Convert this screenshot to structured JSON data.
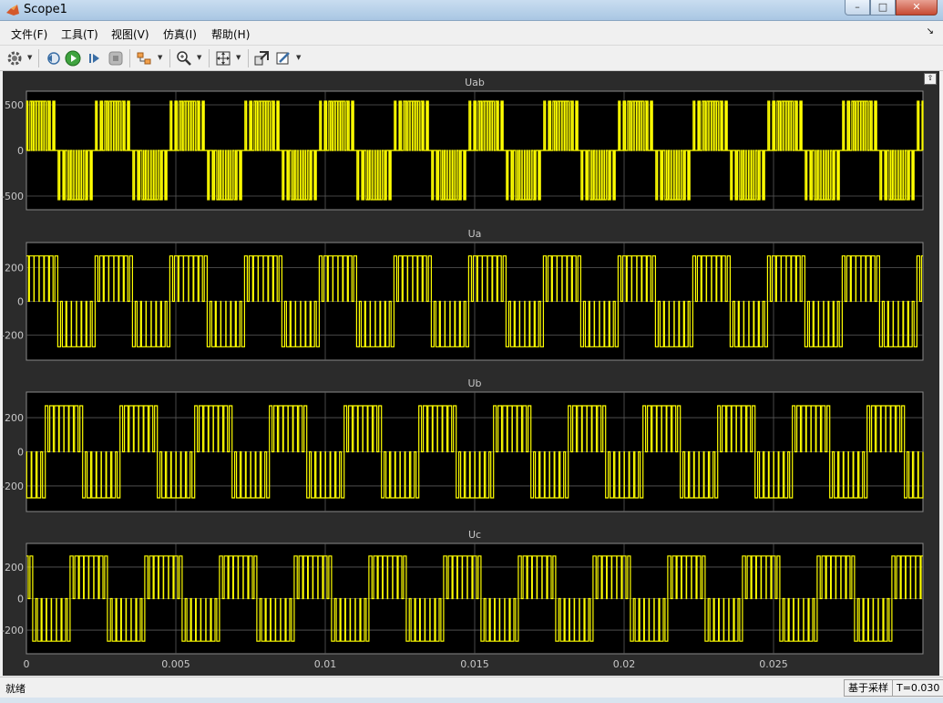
{
  "window": {
    "title": "Scope1"
  },
  "menu": [
    {
      "label": "文件(F)"
    },
    {
      "label": "工具(T)"
    },
    {
      "label": "视图(V)"
    },
    {
      "label": "仿真(I)"
    },
    {
      "label": "帮助(H)"
    }
  ],
  "toolbar": {
    "icons": [
      "gear-icon",
      "step-back-icon",
      "run-icon",
      "step-forward-icon",
      "stop-icon",
      "signal-selector-icon",
      "zoom-icon",
      "autoscale-icon",
      "highlight-block-icon",
      "style-icon"
    ]
  },
  "status": {
    "left": "就绪",
    "mode": "基于采样",
    "time": "T=0.030"
  },
  "colors": {
    "trace": "#ffff00",
    "axes_bg": "#000000",
    "figure_bg": "#2b2b2b",
    "grid": "#5a5a5a",
    "text": "#c8c8c8"
  },
  "chart_data": [
    {
      "type": "line",
      "title": "Uab",
      "xlim": [
        0,
        0.03
      ],
      "ylim": [
        -650,
        650
      ],
      "yticks": [
        -500,
        0,
        500
      ],
      "ytick_labels": [
        "-500",
        "0",
        "500"
      ],
      "xticks": [
        0,
        0.005,
        0.01,
        0.015,
        0.02,
        0.025
      ],
      "series": [
        {
          "signal": "line-to-line PWM, levels ±540/±270/0",
          "fundamental_hz": 400,
          "carrier_hz": 6000,
          "phase_deg": 0
        }
      ]
    },
    {
      "type": "line",
      "title": "Ua",
      "xlim": [
        0,
        0.03
      ],
      "ylim": [
        -350,
        350
      ],
      "yticks": [
        -200,
        0,
        200
      ],
      "ytick_labels": [
        "-200",
        "0",
        "200"
      ],
      "xticks": [
        0,
        0.005,
        0.01,
        0.015,
        0.02,
        0.025
      ],
      "series": [
        {
          "signal": "phase PWM, levels ±270/0",
          "fundamental_hz": 400,
          "carrier_hz": 6000,
          "phase_deg": 30
        }
      ]
    },
    {
      "type": "line",
      "title": "Ub",
      "xlim": [
        0,
        0.03
      ],
      "ylim": [
        -350,
        350
      ],
      "yticks": [
        -200,
        0,
        200
      ],
      "ytick_labels": [
        "-200",
        "0",
        "200"
      ],
      "xticks": [
        0,
        0.005,
        0.01,
        0.015,
        0.02,
        0.025
      ],
      "series": [
        {
          "signal": "phase PWM, levels ±270/0",
          "fundamental_hz": 400,
          "carrier_hz": 6000,
          "phase_deg": -90
        }
      ]
    },
    {
      "type": "line",
      "title": "Uc",
      "xlim": [
        0,
        0.03
      ],
      "ylim": [
        -350,
        350
      ],
      "yticks": [
        -200,
        0,
        200
      ],
      "ytick_labels": [
        "-200",
        "0",
        "200"
      ],
      "xticks": [
        0,
        0.005,
        0.01,
        0.015,
        0.02,
        0.025
      ],
      "xtick_labels": [
        "0",
        "0.005",
        "0.01",
        "0.015",
        "0.02",
        "0.025"
      ],
      "series": [
        {
          "signal": "phase PWM, levels ±270/0",
          "fundamental_hz": 400,
          "carrier_hz": 6000,
          "phase_deg": 150
        }
      ]
    }
  ]
}
